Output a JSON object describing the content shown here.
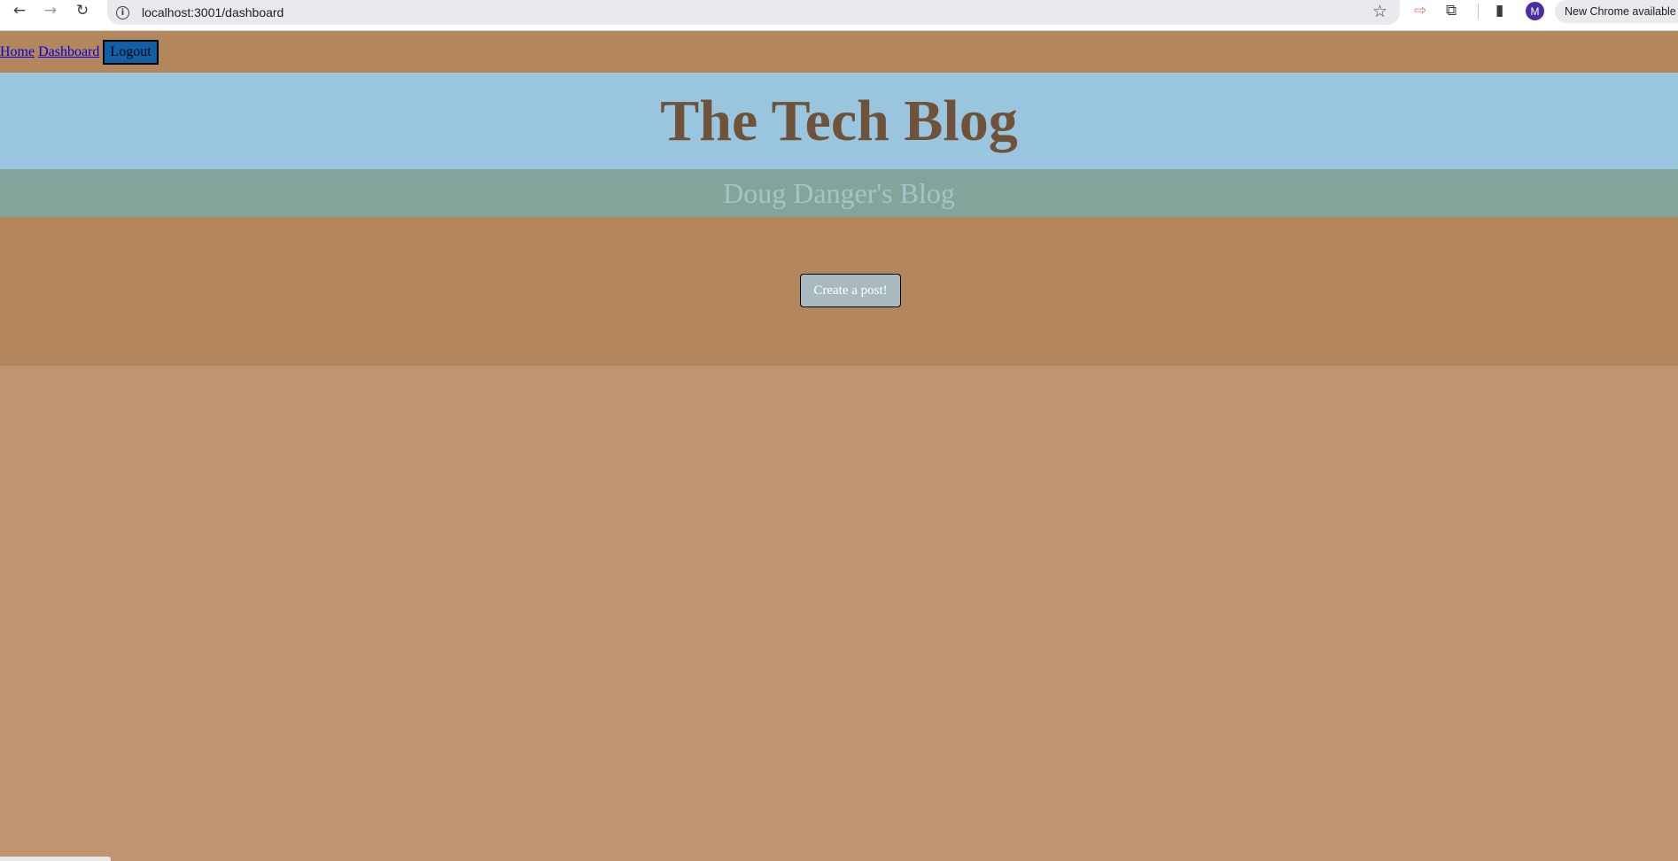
{
  "browser": {
    "url": "localhost:3001/dashboard",
    "update_label": "New Chrome available",
    "avatar_letter": "M",
    "icons": {
      "back": "←",
      "forward": "→",
      "reload": "↻",
      "info": "i",
      "star": "☆",
      "extension_red": "⇨",
      "puzzle": "⧉",
      "sidepanel": "▮"
    }
  },
  "nav": {
    "home": "Home",
    "dashboard": "Dashboard",
    "logout": "Logout"
  },
  "header": {
    "title": "The Tech Blog"
  },
  "subheader": {
    "title": "Doug Danger's Blog"
  },
  "actions": {
    "create_post": "Create a post!"
  },
  "colors": {
    "nav_bg": "#b3865c",
    "hero_bg": "#99c5de",
    "hero_text": "#6f5239",
    "subhead_bg": "#83a49b",
    "subhead_text": "#a9c2c8",
    "page_bg": "#bf9470",
    "logout_bg": "#1060a8",
    "create_btn_bg": "#a8bac0"
  }
}
